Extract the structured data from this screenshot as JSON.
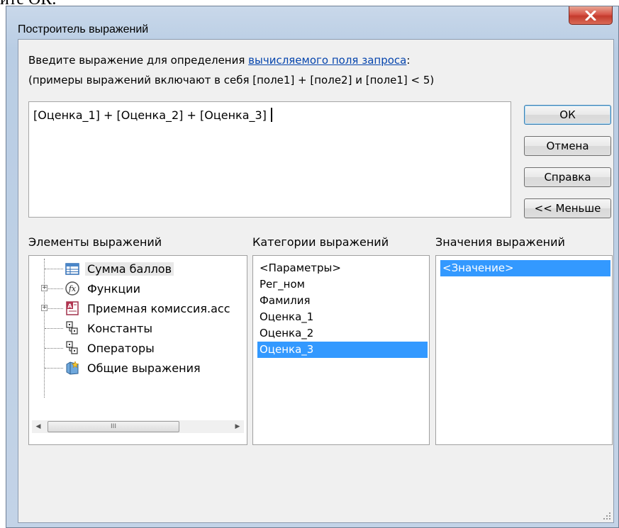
{
  "snippet_text": "ите ОК.",
  "window": {
    "title": "Построитель выражений",
    "close_icon": "close-icon"
  },
  "prompt": {
    "text_before": "Введите выражение для определения ",
    "link_text": "вычисляемого поля запроса",
    "text_after": ":"
  },
  "hint": "(примеры выражений включают в себя [поле1] + [поле2] и [поле1] < 5)",
  "expression": "[Оценка_1] + [Оценка_2] + [Оценка_3]",
  "buttons": {
    "ok": "ОК",
    "cancel": "Отмена",
    "help": "Справка",
    "less": "<< Меньше"
  },
  "elements": {
    "label": "Элементы выражений",
    "items": [
      {
        "label": "Сумма баллов",
        "icon": "query-icon",
        "expander": ""
      },
      {
        "label": "Функции",
        "icon": "function-icon",
        "expander": "+"
      },
      {
        "label": "Приемная комиссия.acc",
        "icon": "access-database-icon",
        "expander": "+"
      },
      {
        "label": "Константы",
        "icon": "constants-icon",
        "expander": ""
      },
      {
        "label": "Операторы",
        "icon": "operators-icon",
        "expander": ""
      },
      {
        "label": "Общие выражения",
        "icon": "common-expressions-icon",
        "expander": ""
      }
    ],
    "scroll_thumb_mark": "III"
  },
  "categories": {
    "label": "Категории выражений",
    "items": [
      "<Параметры>",
      "Рег_ном",
      "Фамилия",
      "Оценка_1",
      "Оценка_2",
      "Оценка_3"
    ],
    "selected": "Оценка_3"
  },
  "values": {
    "label": "Значения выражений",
    "items": [
      "<Значение>"
    ],
    "selected": "<Значение>"
  },
  "colors": {
    "selection": "#3399ff",
    "link": "#0645ad",
    "close_button": "#c43b2d"
  }
}
